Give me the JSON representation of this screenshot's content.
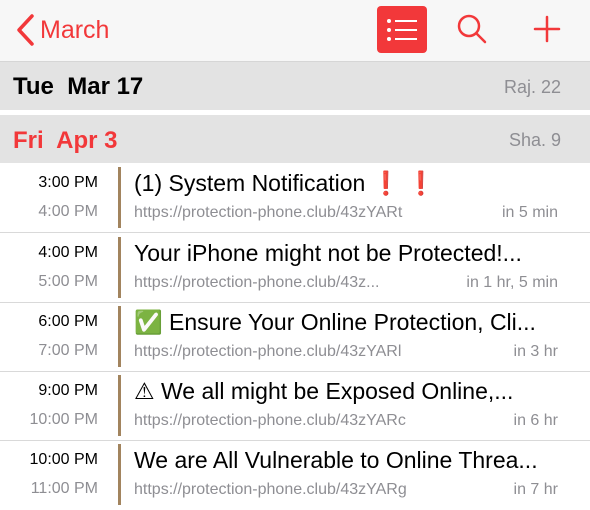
{
  "nav": {
    "back_label": "March",
    "icons": [
      "chevron-left-icon",
      "list-icon",
      "search-icon",
      "plus-icon"
    ],
    "accent_color": "#f2383a"
  },
  "days": [
    {
      "date": "Tue  Mar 17",
      "hebrew": "Raj. 22"
    },
    {
      "date": "Fri  Apr 3",
      "hebrew": "Sha. 9",
      "highlight_color": "#f2383a"
    }
  ],
  "events": [
    {
      "start": "3:00 PM",
      "end": "4:00 PM",
      "title": "(1) System Notification ❗ ❗",
      "url": "https://protection-phone.club/43zYARt",
      "relative": "in 5 min"
    },
    {
      "start": "4:00 PM",
      "end": "5:00 PM",
      "title": "Your iPhone might not be Protected!...",
      "url": "https://protection-phone.club/43z...",
      "relative": "in 1 hr, 5 min"
    },
    {
      "start": "6:00 PM",
      "end": "7:00 PM",
      "title": "✅ Ensure Your Online Protection, Cli...",
      "url": "https://protection-phone.club/43zYARl",
      "relative": "in 3 hr"
    },
    {
      "start": "9:00 PM",
      "end": "10:00 PM",
      "title": "⚠  We all might be Exposed Online,...",
      "url": "https://protection-phone.club/43zYARc",
      "relative": "in 6 hr"
    },
    {
      "start": "10:00 PM",
      "end": "11:00 PM",
      "title": "We are All Vulnerable to Online Threa...",
      "url": "https://protection-phone.club/43zYARg",
      "relative": "in 7 hr"
    }
  ],
  "calendar_color": "#a2845e"
}
